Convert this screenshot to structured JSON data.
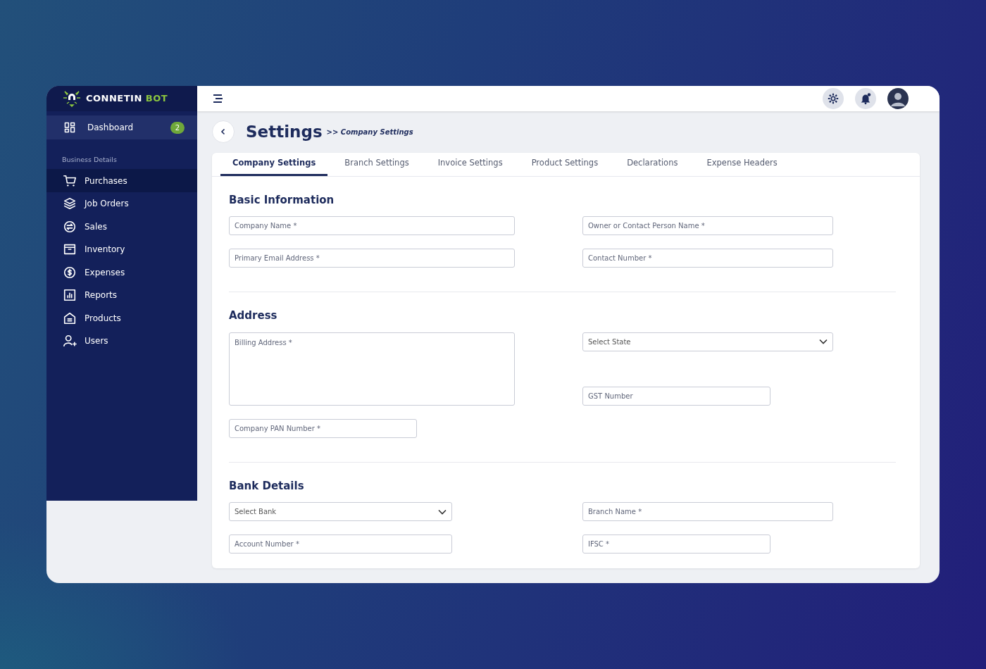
{
  "brand": {
    "name": "CONNETIN",
    "accent": "BOT"
  },
  "sidebar": {
    "dashboard": {
      "label": "Dashboard",
      "badge": "2"
    },
    "section_title": "Business Details",
    "items": [
      {
        "label": "Purchases",
        "selected": true
      },
      {
        "label": "Job Orders",
        "selected": false
      },
      {
        "label": "Sales",
        "selected": false
      },
      {
        "label": "Inventory",
        "selected": false
      },
      {
        "label": "Expenses",
        "selected": false
      },
      {
        "label": "Reports",
        "selected": false
      },
      {
        "label": "Products",
        "selected": false
      },
      {
        "label": "Users",
        "selected": false
      }
    ]
  },
  "page": {
    "title": "Settings",
    "breadcrumb": ">> Company Settings"
  },
  "tabs": [
    {
      "label": "Company Settings",
      "selected": true
    },
    {
      "label": "Branch Settings",
      "selected": false
    },
    {
      "label": "Invoice Settings",
      "selected": false
    },
    {
      "label": "Product Settings",
      "selected": false
    },
    {
      "label": "Declarations",
      "selected": false
    },
    {
      "label": "Expense Headers",
      "selected": false
    }
  ],
  "sections": [
    {
      "title": "Basic Information",
      "left": [
        {
          "kind": "input",
          "placeholder": "Company Name *"
        },
        {
          "kind": "input",
          "placeholder": "Primary Email Address *"
        }
      ],
      "right": [
        {
          "kind": "input",
          "placeholder": "Owner or Contact Person Name *"
        },
        {
          "kind": "input",
          "placeholder": "Contact Number *"
        }
      ]
    },
    {
      "title": "Address",
      "left": [
        {
          "kind": "textarea",
          "placeholder": "Billing Address *"
        },
        {
          "kind": "input",
          "placeholder": "Company PAN Number *"
        }
      ],
      "right": [
        {
          "kind": "select",
          "placeholder": "Select State"
        },
        {
          "kind": "input",
          "placeholder": "GST Number"
        }
      ]
    },
    {
      "title": "Bank Details",
      "left": [
        {
          "kind": "select",
          "placeholder": "Select Bank"
        },
        {
          "kind": "input",
          "placeholder": "Account Number *"
        }
      ],
      "right": [
        {
          "kind": "input",
          "placeholder": "Branch Name *"
        },
        {
          "kind": "input",
          "placeholder": "IFSC *"
        }
      ]
    }
  ]
}
